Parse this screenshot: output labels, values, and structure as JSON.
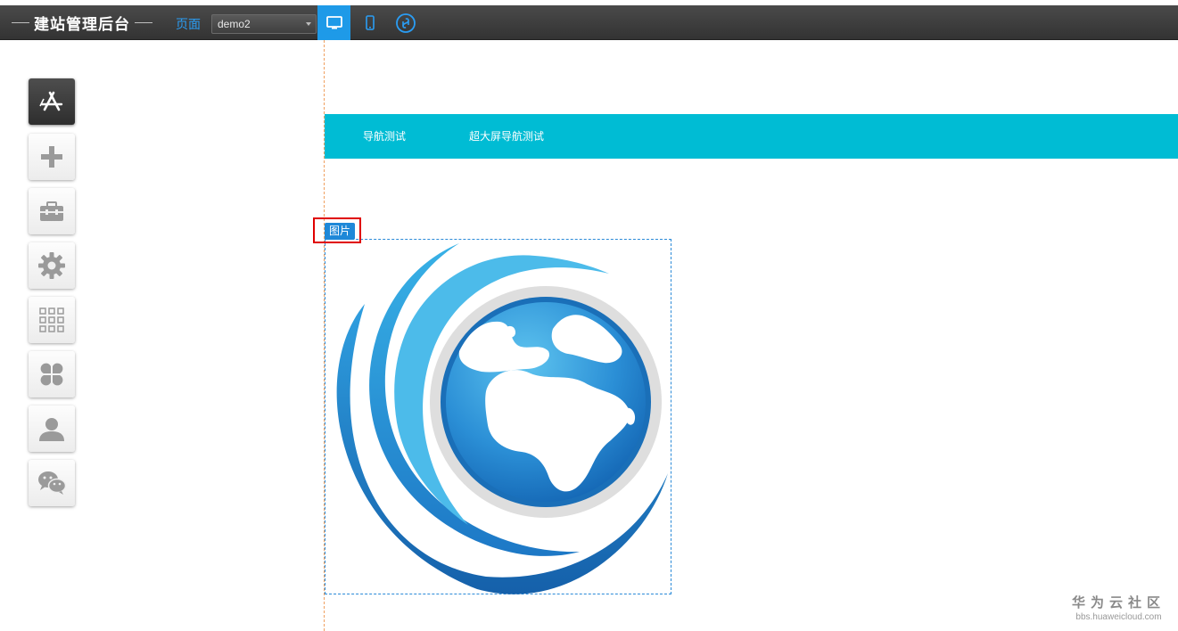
{
  "header": {
    "title": "建站管理后台",
    "page_label": "页面",
    "page_select_value": "demo2",
    "device_buttons": [
      {
        "name": "desktop-icon",
        "active": true
      },
      {
        "name": "mobile-icon",
        "active": false
      },
      {
        "name": "mini-program-icon",
        "active": false
      }
    ]
  },
  "sidebar": {
    "tools": [
      {
        "icon": "app-store-icon",
        "active": true
      },
      {
        "icon": "plus-icon",
        "active": false
      },
      {
        "icon": "toolbox-icon",
        "active": false
      },
      {
        "icon": "gear-icon",
        "active": false
      },
      {
        "icon": "grid-icon",
        "active": false
      },
      {
        "icon": "clover-icon",
        "active": false
      },
      {
        "icon": "user-icon",
        "active": false
      },
      {
        "icon": "wechat-icon",
        "active": false
      }
    ]
  },
  "canvas": {
    "nav_items": [
      "导航测试",
      "超大屏导航测试"
    ],
    "image_component_label": "图片",
    "nav_color": "#00bcd4",
    "accent_color": "#1e9ae8"
  },
  "watermark": {
    "main": "华为云社区",
    "sub": "bbs.huaweicloud.com"
  }
}
